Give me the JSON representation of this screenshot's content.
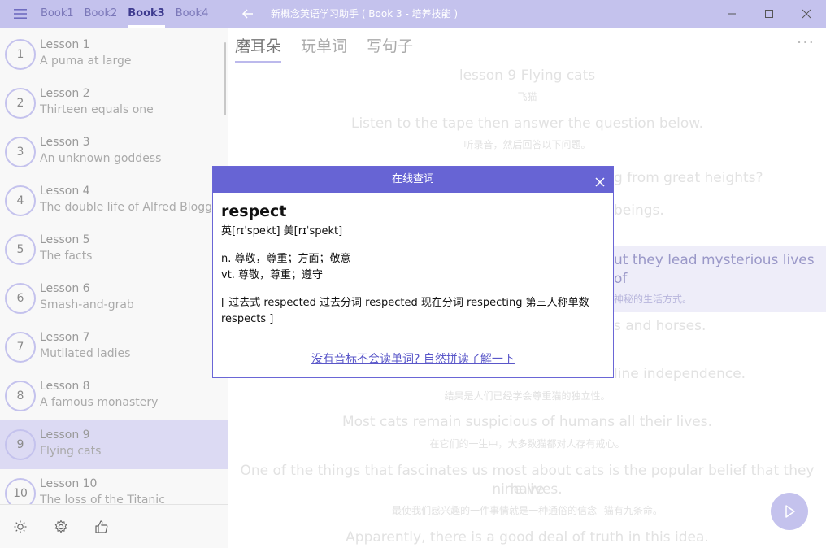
{
  "titlebar": {
    "books": [
      "Book1",
      "Book2",
      "Book3",
      "Book4"
    ],
    "active_book": 2,
    "window_title": "新概念英语学习助手 ( Book 3 - 培养技能 )"
  },
  "sidebar": {
    "lessons": [
      {
        "num": "1",
        "title": "Lesson 1",
        "subtitle": "A puma at large"
      },
      {
        "num": "2",
        "title": "Lesson 2",
        "subtitle": "Thirteen equals one"
      },
      {
        "num": "3",
        "title": "Lesson 3",
        "subtitle": "An unknown goddess"
      },
      {
        "num": "4",
        "title": "Lesson 4",
        "subtitle": "The double life of Alfred Bloggs"
      },
      {
        "num": "5",
        "title": "Lesson 5",
        "subtitle": "The facts"
      },
      {
        "num": "6",
        "title": "Lesson 6",
        "subtitle": "Smash-and-grab"
      },
      {
        "num": "7",
        "title": "Lesson 7",
        "subtitle": "Mutilated ladies"
      },
      {
        "num": "8",
        "title": "Lesson 8",
        "subtitle": "A famous monastery"
      },
      {
        "num": "9",
        "title": "Lesson 9",
        "subtitle": "Flying cats"
      },
      {
        "num": "10",
        "title": "Lesson 10",
        "subtitle": "The loss of the Titanic"
      }
    ],
    "selected_index": 8
  },
  "main": {
    "tabs": [
      "磨耳朵",
      "玩单词",
      "写句子"
    ],
    "active_tab": 0,
    "more": "···",
    "lines": [
      {
        "type": "en",
        "text": "lesson 9  Flying cats"
      },
      {
        "type": "zh",
        "text": "飞猫"
      },
      {
        "type": "en",
        "text": "Listen to the tape then answer the question below."
      },
      {
        "type": "zh",
        "text": "听录音，然后回答以下问题。"
      },
      {
        "type": "en",
        "text": "g from great heights?"
      },
      {
        "type": "en",
        "text": "beings."
      },
      {
        "type": "en",
        "text": "ut they lead mysterious lives of"
      },
      {
        "type": "zh",
        "text": "神秘的生活方式。"
      },
      {
        "type": "en",
        "text": "s and horses."
      },
      {
        "type": "en",
        "text": "line independence."
      },
      {
        "type": "zh",
        "text": "结果是人们已经学会尊重猫的独立性。"
      },
      {
        "type": "en",
        "text": "Most cats remain suspicious of humans all their lives."
      },
      {
        "type": "zh",
        "text": "在它们的一生中，大多数猫都对人存有戒心。"
      },
      {
        "type": "en",
        "text": "One of the things that fascinates us most about cats is the popular belief that they have"
      },
      {
        "type": "en",
        "text": "nine lives."
      },
      {
        "type": "zh",
        "text": "最使我们感兴趣的一件事情就是一种通俗的信念--猫有九条命。"
      },
      {
        "type": "en",
        "text": "Apparently, there is a good deal of truth in this idea."
      }
    ]
  },
  "dialog": {
    "title": "在线查词",
    "word": "respect",
    "phonetic": "英[rɪˈspekt]  美[rɪˈspekt]",
    "meanings": [
      "n. 尊敬，尊重；方面；敬意",
      "vt. 尊敬，尊重；遵守"
    ],
    "forms": "[ 过去式 respected 过去分词 respected 现在分词 respecting 第三人称单数 respects ]",
    "link": "没有音标不会读单词? 自然拼读了解一下"
  }
}
